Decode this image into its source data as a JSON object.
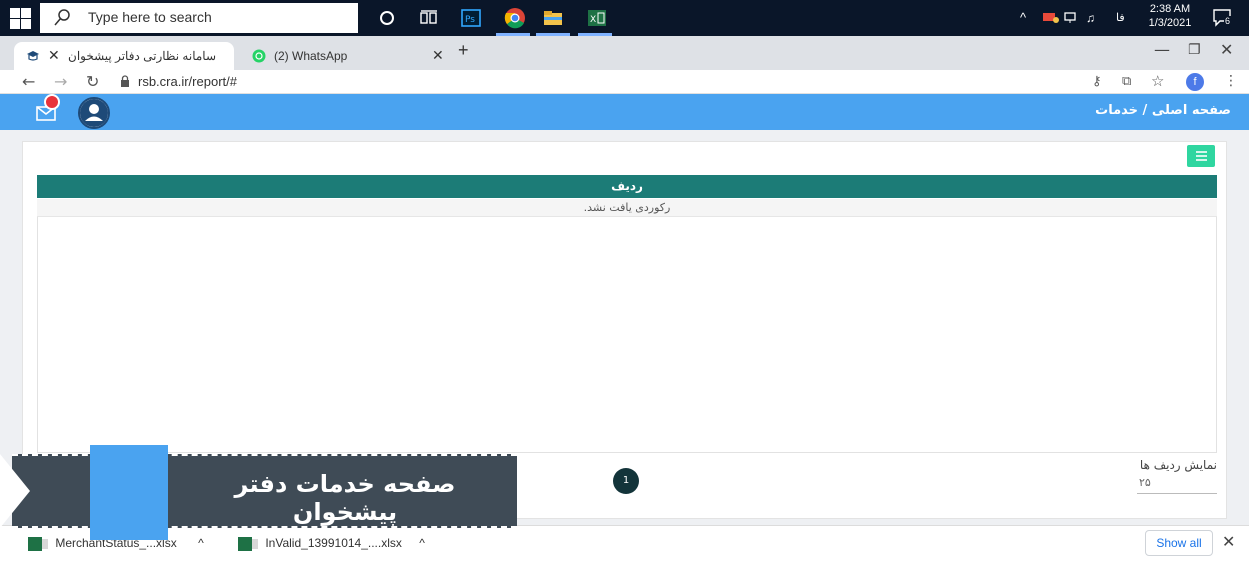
{
  "taskbar": {
    "search_placeholder": "Type here to search",
    "time": "2:38 AM",
    "date": "1/3/2021",
    "notifications_count": "6"
  },
  "tabs": [
    {
      "label": "سامانه نظارتی دفاتر پیشخوان",
      "active": true
    },
    {
      "label": "(2) WhatsApp",
      "active": false
    }
  ],
  "address": {
    "url": "rsb.cra.ir/report/#",
    "profile_initial": "f"
  },
  "header": {
    "breadcrumb": "صفحه اصلی / خدمات",
    "mail_badge": "•"
  },
  "table": {
    "column_header": "ردیف",
    "empty_message": "رکوردی یافت نشد.",
    "rows_per_page_label": "نمایش ردیف ها",
    "rows_per_page_value": "۲۵",
    "current_page": "1"
  },
  "downloads": {
    "items": [
      {
        "name": "MerchantStatus_...xlsx"
      },
      {
        "name": "InValid_13991014_....xlsx"
      }
    ],
    "show_all": "Show all"
  },
  "banner": {
    "text": "صفحه خدمات دفتر پیشخوان"
  },
  "colors": {
    "header_blue": "#4aa3f0",
    "table_head": "#1c7c77",
    "list_button": "#2fd6a0",
    "badge_red": "#e8333b"
  }
}
